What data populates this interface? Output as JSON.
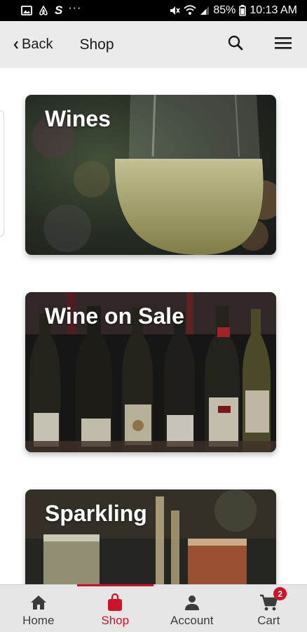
{
  "status_bar": {
    "dots": "···",
    "battery_percent": "85%",
    "time": "10:13 AM"
  },
  "header": {
    "back_label": "Back",
    "title": "Shop"
  },
  "categories": [
    {
      "label": "Wines"
    },
    {
      "label": "Wine on Sale"
    },
    {
      "label": "Sparkling"
    }
  ],
  "bottom_nav": {
    "active": "Shop",
    "items": [
      {
        "label": "Home",
        "icon": "home-icon"
      },
      {
        "label": "Shop",
        "icon": "shopping-bag-icon"
      },
      {
        "label": "Account",
        "icon": "person-icon"
      },
      {
        "label": "Cart",
        "icon": "cart-icon",
        "badge": "2"
      }
    ]
  },
  "colors": {
    "accent": "#d0112b",
    "appbar_bg": "#ebebeb",
    "nav_bg": "#e6e6e6",
    "status_bar_bg": "#000000"
  }
}
